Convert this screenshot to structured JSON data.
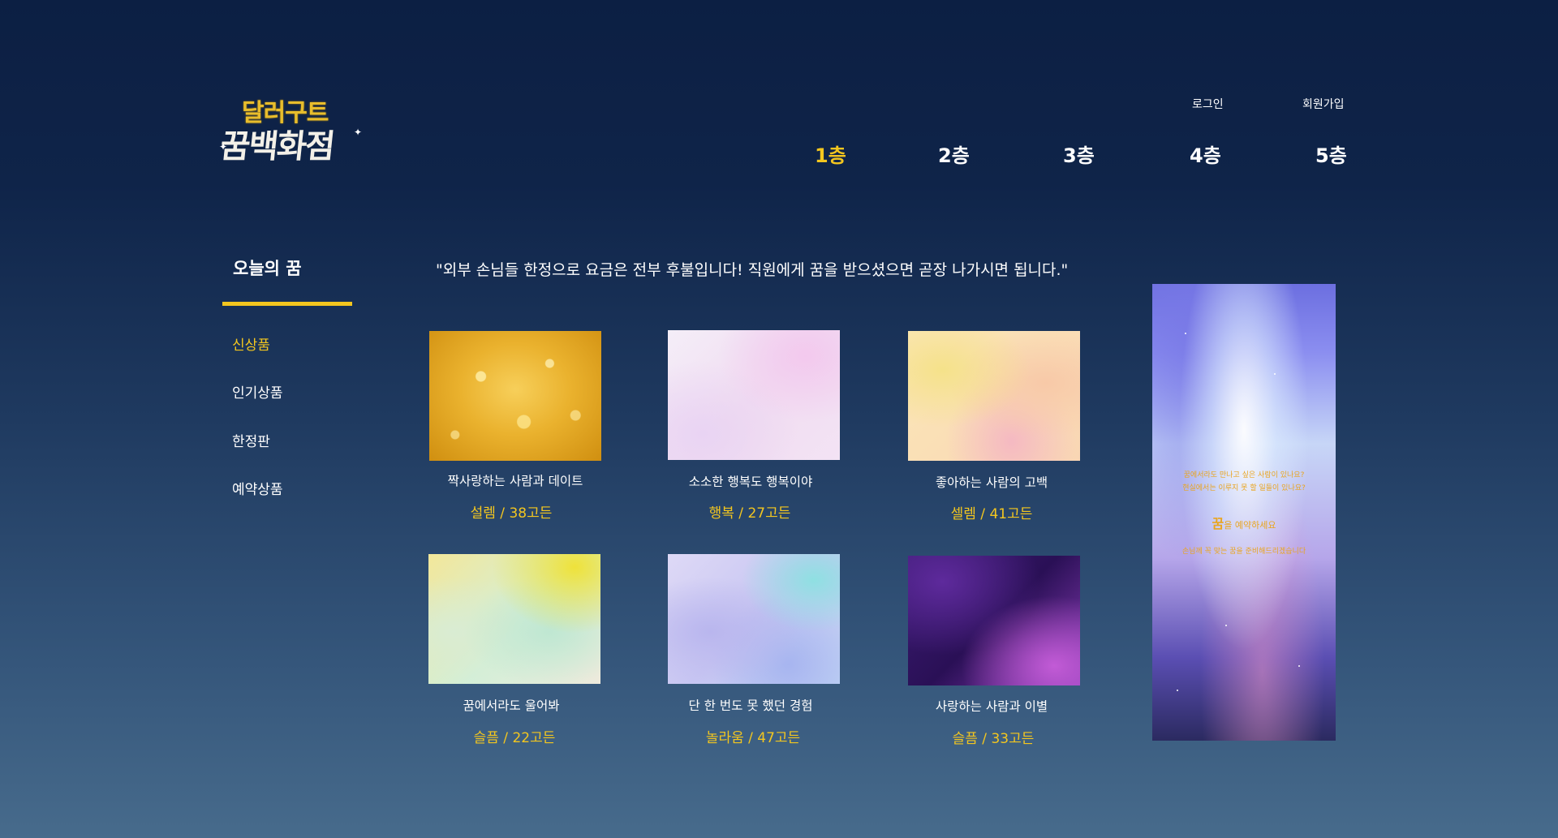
{
  "logo": {
    "line1": "달러구트",
    "line2": "꿈백화점"
  },
  "header": {
    "login": "로그인",
    "signup": "회원가입"
  },
  "floors": [
    "1층",
    "2층",
    "3층",
    "4층",
    "5층"
  ],
  "sidebar": {
    "title": "오늘의 꿈",
    "items": [
      "신상품",
      "인기상품",
      "한정판",
      "예약상품"
    ]
  },
  "notice": "\"외부 손님들 한정으로 요금은 전부 후불입니다! 직원에게 꿈을 받으셨으면 곧장 나가시면 됩니다.\"",
  "products": [
    {
      "name": "짝사랑하는 사람과 데이트",
      "price": "설렘 / 38고든"
    },
    {
      "name": "소소한 행복도 행복이야",
      "price": "행복 / 27고든"
    },
    {
      "name": "좋아하는 사람의 고백",
      "price": "셀렘 / 41고든"
    },
    {
      "name": "꿈에서라도 울어봐",
      "price": "슬픔 / 22고든"
    },
    {
      "name": "단 한 번도 못 했던 경험",
      "price": "놀라움 / 47고든"
    },
    {
      "name": "사랑하는 사람과 이별",
      "price": "슬픔 / 33고든"
    }
  ],
  "banner": {
    "line1": "꿈에서라도 만나고 싶은 사람이 있나요?",
    "line2": "현실에서는 이루지 못 할 일들이 있나요?",
    "big": "꿈",
    "line3": "을 예약하세요",
    "line4": "손님께 꼭 맞는 꿈을 준비해드리겠습니다"
  },
  "colors": {
    "accent": "#f3c61f",
    "bg_top": "#0c1f43",
    "bg_bottom": "#476b8c"
  }
}
